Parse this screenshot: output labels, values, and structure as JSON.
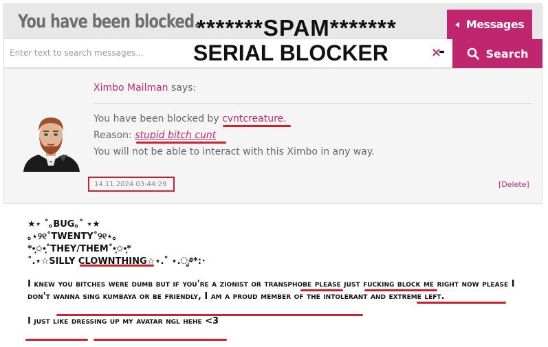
{
  "header": {
    "title": "You have been blocked.",
    "spam_text": "*******SPAM*******",
    "messages_button": "Messages"
  },
  "search": {
    "placeholder": "Enter text to search messages...",
    "overlay_text": "SERIAL BLOCKER",
    "button_label": "Search"
  },
  "message": {
    "sender": "Ximbo Mailman",
    "says": " says:",
    "line1_prefix": "You have been blocked by ",
    "blocker": "cvntcreature.",
    "reason_label": "Reason: ",
    "reason": "stupid bitch cunt",
    "line3": "You will not be able to interact with this Ximbo in any way.",
    "timestamp": "14.11.2024 03:44:29",
    "delete": "[Delete]"
  },
  "bio": {
    "header_lines": [
      "★⋆ ˚｡BUG｡˚ ⋆★",
      "｡⋆୨୧˚TWENTY˚୨୧⋆｡",
      "*•̩̩͙✩•̩̩͙˚THEY/THEM˚•̩̩͙✩•̩̩͙*",
      "˚.⋆☆SILLY CLOWNTHING☆⋆.˚ ⋆.ೃ࿔*:･"
    ],
    "paragraph1": "I knew you bitches were dumb but if you're a zionist or transphobe please just fucking block me right now please I don't wanna sing kumbaya or be friendly, I am a proud member of the intolerant and extreme left.",
    "paragraph2": "I just like dressing up my avatar ngl hehe <3"
  },
  "colors": {
    "accent": "#c0266f",
    "annotation_red": "#d0202c"
  }
}
